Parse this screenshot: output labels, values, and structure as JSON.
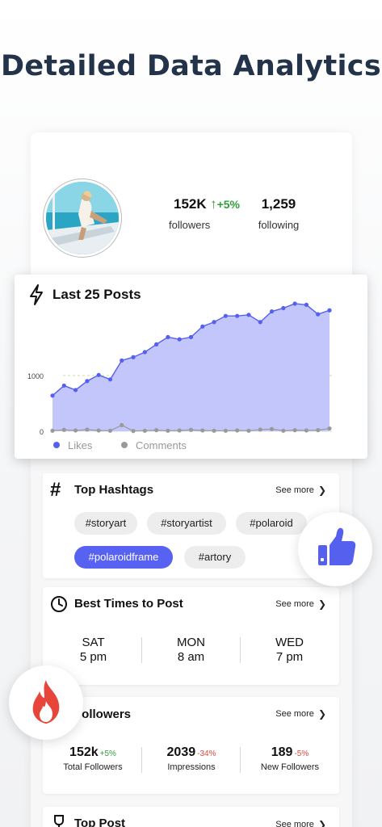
{
  "headline": "Detailed Data Analytics",
  "profile": {
    "followers_value": "152K",
    "followers_change": "+5%",
    "followers_label": "followers",
    "following_value": "1,259",
    "following_label": "following"
  },
  "posts_card": {
    "title": "Last 25 Posts",
    "icon": "lightning-icon"
  },
  "chart_data": {
    "type": "area",
    "title": "Last 25 Posts",
    "x": [
      1,
      2,
      3,
      4,
      5,
      6,
      7,
      8,
      9,
      10,
      11,
      12,
      13,
      14,
      15,
      16,
      17,
      18,
      19,
      20,
      21,
      22,
      23,
      24,
      25
    ],
    "yticks": [
      "0",
      "1000"
    ],
    "ylim": [
      0,
      2000
    ],
    "series": [
      {
        "name": "Likes",
        "color": "#5560ee",
        "fill": "#c2c6fb",
        "values": [
          640,
          820,
          740,
          900,
          1010,
          930,
          1270,
          1330,
          1420,
          1560,
          1690,
          1650,
          1690,
          1880,
          1960,
          2070,
          2070,
          2090,
          1960,
          2150,
          2210,
          2290,
          2270,
          2100,
          2170
        ]
      },
      {
        "name": "Comments",
        "color": "#999999",
        "values": [
          10,
          25,
          15,
          30,
          15,
          10,
          110,
          5,
          10,
          20,
          10,
          15,
          25,
          15,
          10,
          10,
          15,
          10,
          30,
          40,
          10,
          20,
          15,
          20,
          50
        ]
      }
    ],
    "legend": "bottom-left"
  },
  "hashtags": {
    "title": "Top Hashtags",
    "see_more": "See more",
    "tags": [
      "#storyart",
      "#storyartist",
      "#polaroid",
      "#polaroidframe",
      "#artory"
    ]
  },
  "best_times": {
    "title": "Best Times to Post",
    "see_more": "See more",
    "slots": [
      {
        "day": "SAT",
        "time": "5 pm"
      },
      {
        "day": "MON",
        "time": "8 am"
      },
      {
        "day": "WED",
        "time": "7 pm"
      }
    ]
  },
  "followers_card": {
    "title": "Followers",
    "see_more": "See more",
    "stats": [
      {
        "value": "152k",
        "change": "+5%",
        "label": "Total Followers",
        "trend": "up"
      },
      {
        "value": "2039",
        "change": "-34%",
        "label": "Impressions",
        "trend": "down"
      },
      {
        "value": "189",
        "change": "-5%",
        "label": "New Followers",
        "trend": "down"
      }
    ]
  },
  "top_post": {
    "title": "Top Post",
    "see_more": "See more"
  },
  "colors": {
    "accent": "#5762f2",
    "headline": "#23334a",
    "positive": "#2e9e3a",
    "negative": "#e0453c",
    "thumbs": "#5560ee",
    "flame": "#e8453a"
  }
}
